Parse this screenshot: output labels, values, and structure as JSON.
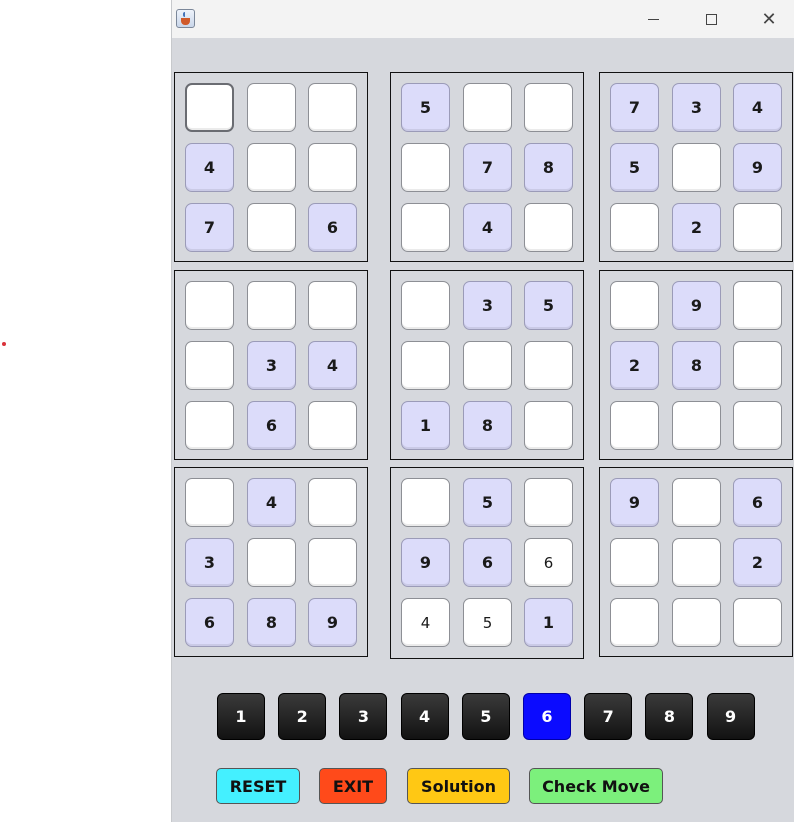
{
  "window": {
    "title": ""
  },
  "colors": {
    "given": "#dcdcfa",
    "selected_number": "#0b0bff",
    "reset": "#44f0ff",
    "exit": "#ff4a1a",
    "solution": "#ffc814",
    "check_move": "#7cf07c"
  },
  "blocks": [
    {
      "cells": [
        "",
        "",
        "",
        "4",
        "",
        "",
        "7",
        "",
        "6"
      ],
      "given": [
        0,
        0,
        0,
        1,
        0,
        0,
        1,
        0,
        1
      ]
    },
    {
      "cells": [
        "5",
        "",
        "",
        "",
        "7",
        "8",
        "",
        "4",
        ""
      ],
      "given": [
        1,
        0,
        0,
        0,
        1,
        1,
        0,
        1,
        0
      ]
    },
    {
      "cells": [
        "7",
        "3",
        "4",
        "5",
        "",
        "9",
        "",
        "2",
        ""
      ],
      "given": [
        1,
        1,
        1,
        1,
        0,
        1,
        0,
        1,
        0
      ]
    },
    {
      "cells": [
        "",
        "",
        "",
        "",
        "3",
        "4",
        "",
        "6",
        ""
      ],
      "given": [
        0,
        0,
        0,
        0,
        1,
        1,
        0,
        1,
        0
      ]
    },
    {
      "cells": [
        "",
        "3",
        "5",
        "",
        "",
        "",
        "1",
        "8",
        ""
      ],
      "given": [
        0,
        1,
        1,
        0,
        0,
        0,
        1,
        1,
        0
      ]
    },
    {
      "cells": [
        "",
        "9",
        "",
        "2",
        "8",
        "",
        "",
        "",
        ""
      ],
      "given": [
        0,
        1,
        0,
        1,
        1,
        0,
        0,
        0,
        0
      ]
    },
    {
      "cells": [
        "",
        "4",
        "",
        "3",
        "",
        "",
        "6",
        "8",
        "9"
      ],
      "given": [
        0,
        1,
        0,
        1,
        0,
        0,
        1,
        1,
        1
      ]
    },
    {
      "cells": [
        "",
        "5",
        "",
        "9",
        "6",
        "6",
        "4",
        "5",
        "1"
      ],
      "given": [
        0,
        1,
        0,
        1,
        1,
        2,
        2,
        2,
        1
      ]
    },
    {
      "cells": [
        "9",
        "",
        "6",
        "",
        "",
        "2",
        "",
        "",
        ""
      ],
      "given": [
        1,
        0,
        1,
        0,
        0,
        1,
        0,
        0,
        0
      ]
    }
  ],
  "number_buttons": [
    "1",
    "2",
    "3",
    "4",
    "5",
    "6",
    "7",
    "8",
    "9"
  ],
  "selected_number": "6",
  "actions": {
    "reset": "RESET",
    "exit": "EXIT",
    "solution": "Solution",
    "check_move": "Check Move"
  }
}
